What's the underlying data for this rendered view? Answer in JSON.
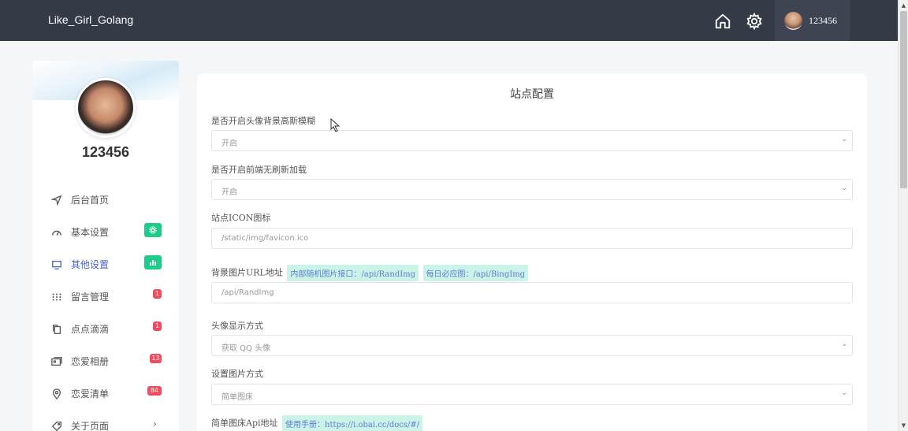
{
  "topbar": {
    "brand": "Like_Girl_Golang",
    "home_icon": "home-icon",
    "settings_icon": "gear-icon",
    "user_name": "123456"
  },
  "sidebar": {
    "profile_name": "123456",
    "items": [
      {
        "label": "后台首页",
        "icon": "navigation-arrow-icon"
      },
      {
        "label": "基本设置",
        "icon": "dashboard-gauge-icon",
        "badge_type": "green"
      },
      {
        "label": "其他设置",
        "icon": "monitor-icon",
        "badge_type": "green"
      },
      {
        "label": "留言管理",
        "icon": "grid-dots-icon",
        "badge": "1"
      },
      {
        "label": "点点滴滴",
        "icon": "copy-icon",
        "badge": "1"
      },
      {
        "label": "恋爱相册",
        "icon": "photo-album-icon",
        "badge": "13"
      },
      {
        "label": "恋爱清单",
        "icon": "location-pin-icon",
        "badge": "84"
      },
      {
        "label": "关于页面",
        "icon": "tag-icon"
      }
    ]
  },
  "panel": {
    "title": "站点配置",
    "fields": [
      {
        "label": "是否开启头像背景高斯模糊",
        "value": "开启"
      },
      {
        "label": "是否开启前端无刷新加载",
        "value": "开启"
      },
      {
        "label": "站点ICON图标",
        "placeholder": "/static/img/favicon.ico"
      },
      {
        "label": "背景图片URL地址",
        "placeholder": "/api/RandImg",
        "tags": [
          "内部随机图片接口：/api/RandImg",
          "每日必应图：/api/BingImg"
        ]
      },
      {
        "label": "头像显示方式",
        "value": "获取 QQ 头像"
      },
      {
        "label": "设置图片方式",
        "value": "简单图床"
      },
      {
        "label": "简单图床Api地址",
        "tags": [
          "使用手册：https://i.obai.cc/docs/#/"
        ]
      }
    ]
  },
  "colors": {
    "topbar": "#343a46",
    "accent_green": "#1ecc8a",
    "badge_red": "#f04b5e",
    "active_blue": "#4a62c8",
    "tag_bg": "#ccf3e7"
  }
}
